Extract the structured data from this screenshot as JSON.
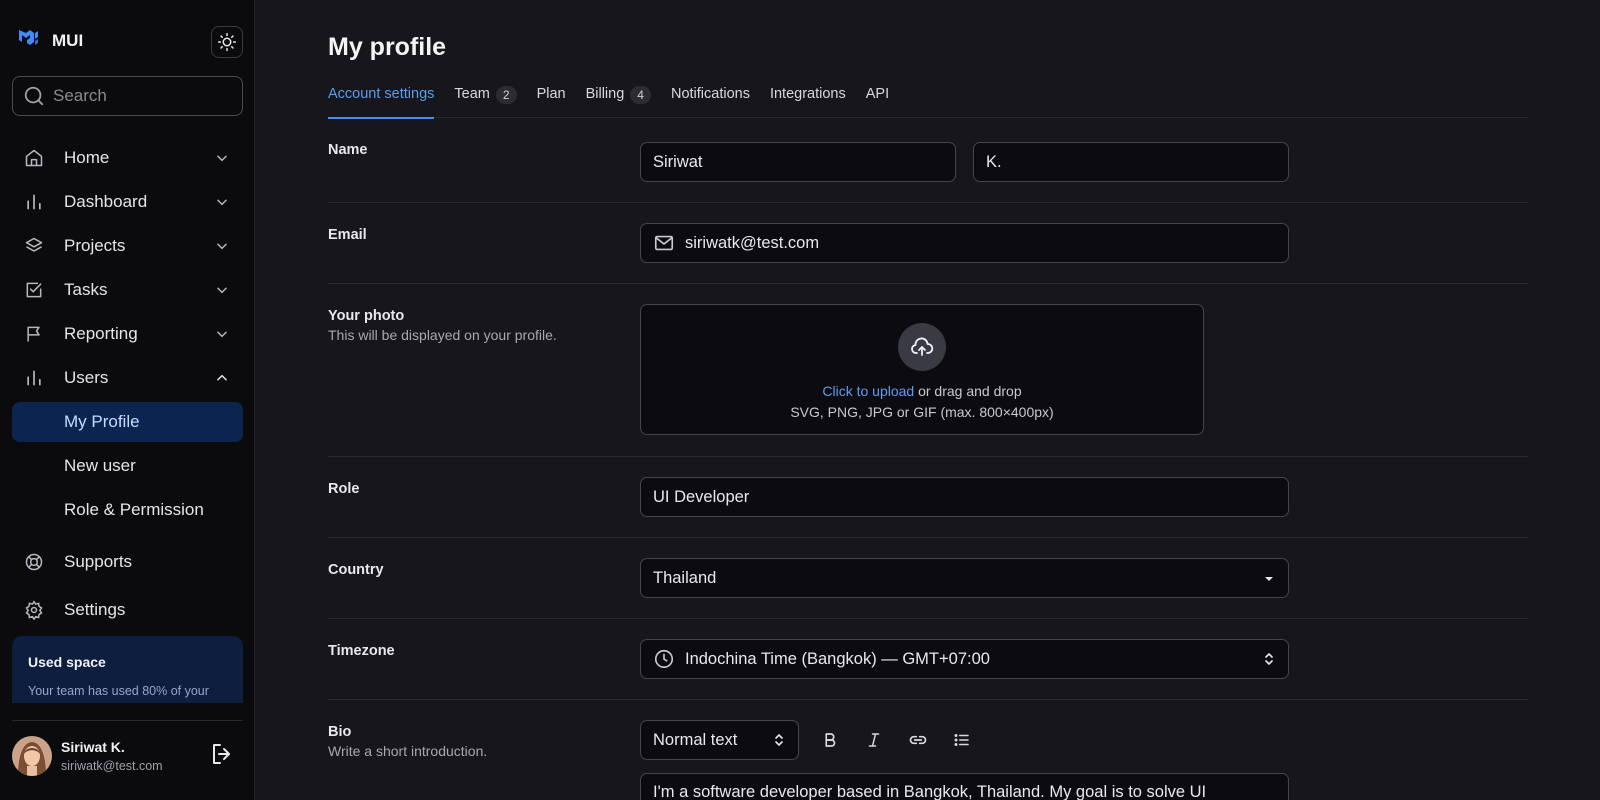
{
  "brand": {
    "name": "MUI"
  },
  "search": {
    "placeholder": "Search"
  },
  "nav": {
    "home": "Home",
    "dashboard": "Dashboard",
    "projects": "Projects",
    "tasks": "Tasks",
    "reporting": "Reporting",
    "users": "Users",
    "users_sub": [
      "My Profile",
      "New user",
      "Role & Permission"
    ],
    "supports": "Supports",
    "settings": "Settings"
  },
  "used_space": {
    "title": "Used space",
    "text": "Your team has used 80% of your"
  },
  "current_user": {
    "name": "Siriwat K.",
    "email": "siriwatk@test.com"
  },
  "page": {
    "title": "My profile"
  },
  "tabs": [
    {
      "label": "Account settings",
      "badge": ""
    },
    {
      "label": "Team",
      "badge": "2"
    },
    {
      "label": "Plan",
      "badge": ""
    },
    {
      "label": "Billing",
      "badge": "4"
    },
    {
      "label": "Notifications",
      "badge": ""
    },
    {
      "label": "Integrations",
      "badge": ""
    },
    {
      "label": "API",
      "badge": ""
    }
  ],
  "form": {
    "name_label": "Name",
    "first_name": "Siriwat",
    "last_name": "K.",
    "email_label": "Email",
    "email": "siriwatk@test.com",
    "photo_label": "Your photo",
    "photo_sub": "This will be displayed on your profile.",
    "upload_link": "Click to upload",
    "upload_text": " or drag and drop",
    "upload_formats": "SVG, PNG, JPG or GIF (max. 800×400px)",
    "role_label": "Role",
    "role": "UI Developer",
    "country_label": "Country",
    "country": "Thailand",
    "timezone_label": "Timezone",
    "timezone": "Indochina Time (Bangkok) — GMT+07:00",
    "bio_label": "Bio",
    "bio_sub": "Write a short introduction.",
    "text_style": "Normal text",
    "bio_text": "I'm a software developer based in Bangkok, Thailand. My goal is to solve UI"
  },
  "colors": {
    "accent": "#5b9cf5",
    "active_nav_bg": "#0c2450",
    "used_card_bg": "#0d1e3e"
  }
}
